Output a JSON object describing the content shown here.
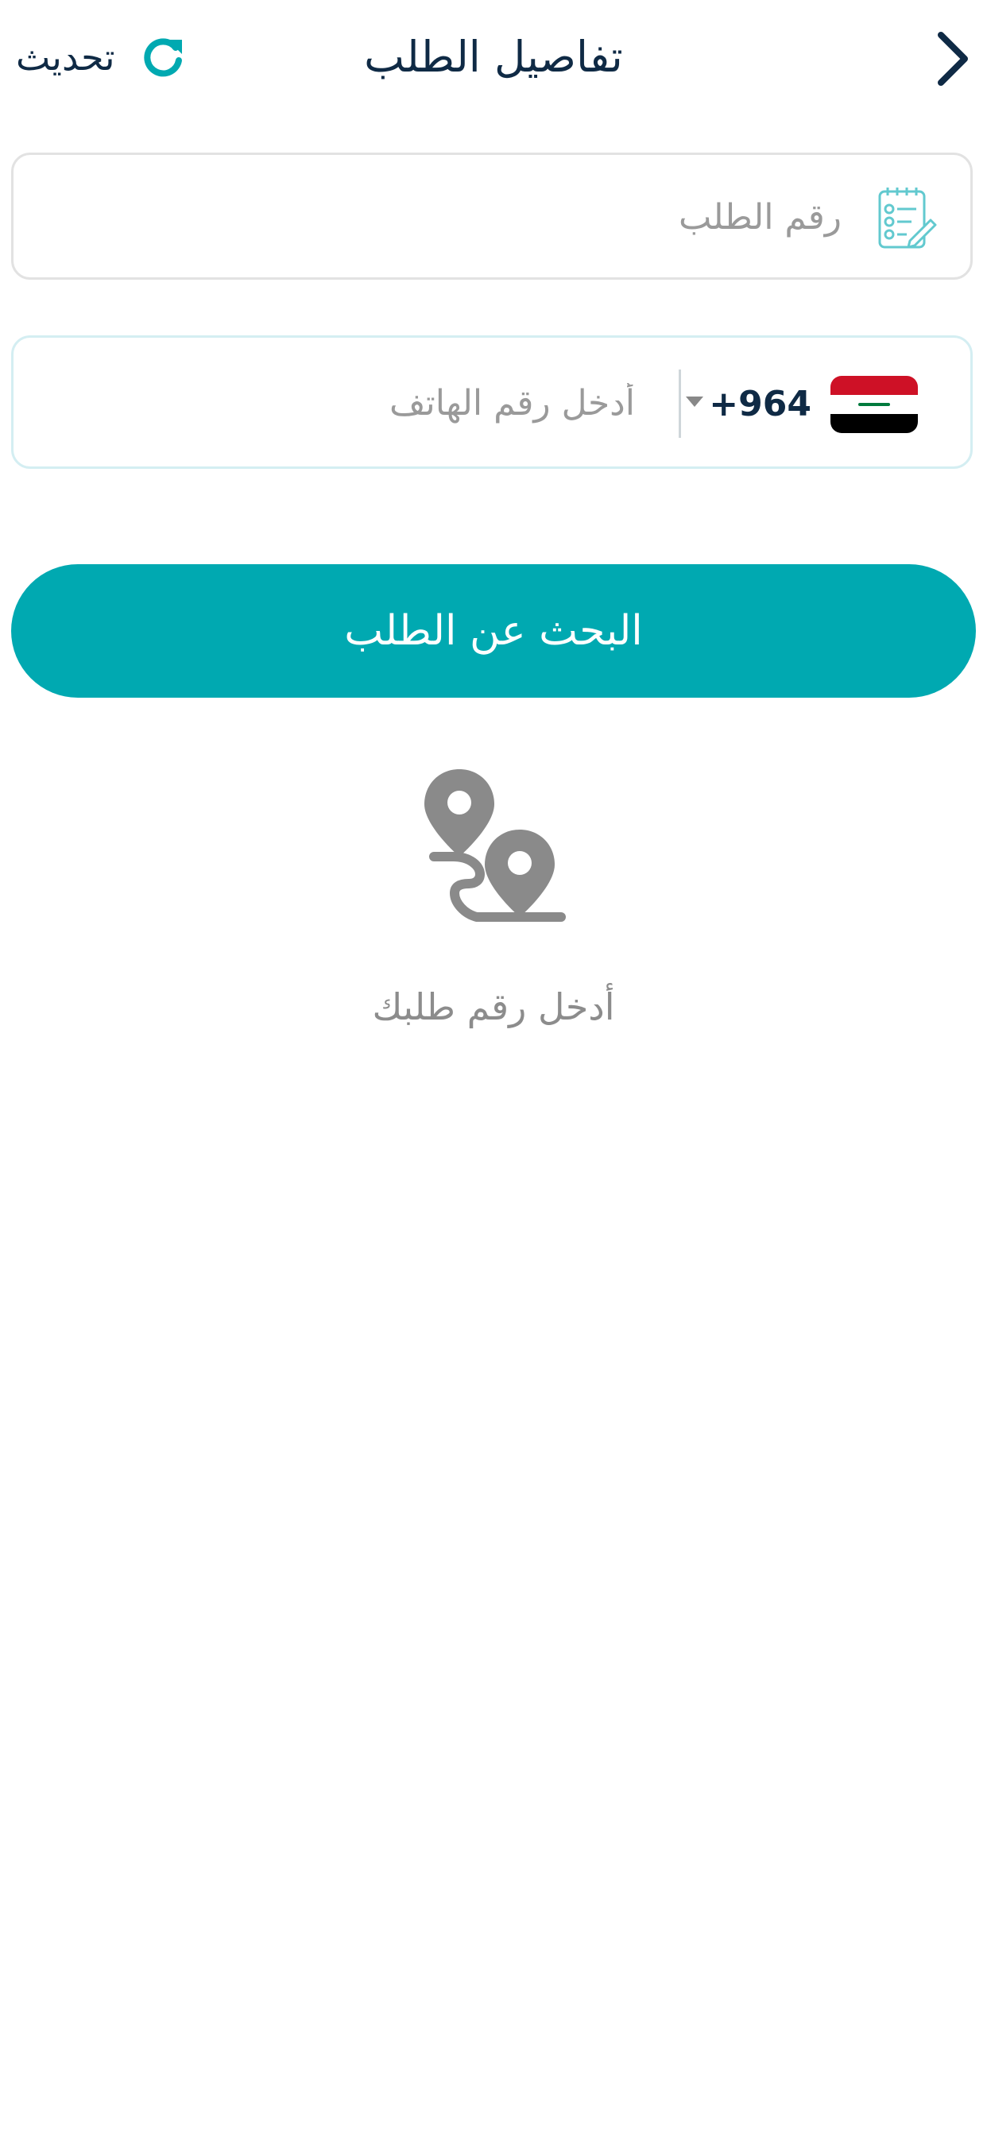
{
  "header": {
    "title": "تفاصيل الطلب",
    "refresh_label": "تحديث",
    "back_icon": "chevron-right-icon",
    "refresh_icon": "refresh-icon"
  },
  "order_field": {
    "placeholder": "رقم الطلب",
    "value": "",
    "icon": "checklist-pencil-icon"
  },
  "phone_field": {
    "country_flag": "iraq-flag-icon",
    "dial_code": "+964",
    "placeholder": "أدخل رقم الهاتف",
    "value": ""
  },
  "search_button": {
    "label": "البحث عن الطلب"
  },
  "empty_state": {
    "icon": "route-pins-icon",
    "message": "أدخل رقم طلبك"
  },
  "colors": {
    "accent": "#00a9b1",
    "title_text": "#0f2a45",
    "placeholder": "#9a9a9a",
    "empty_icon": "#8a8a8a"
  }
}
